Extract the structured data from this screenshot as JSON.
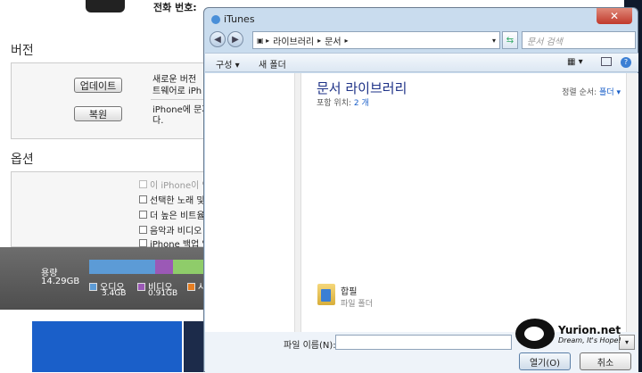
{
  "itunes": {
    "serial_label": "전화 번호:",
    "version_title": "버전",
    "update_button": "업데이트",
    "restore_button": "복원",
    "update_text_1": "새로운 버전",
    "update_text_2": "트웨어로 iPh",
    "restore_text_1": "iPhone에 문자",
    "restore_text_2": "다.",
    "options_title": "옵션",
    "options": [
      {
        "label": "이 iPhone이 연",
        "checked": false,
        "disabled": true
      },
      {
        "label": "선택한 노래 및",
        "checked": false,
        "disabled": false
      },
      {
        "label": "더 높은 비트율",
        "checked": false,
        "disabled": false
      },
      {
        "label": "음악과 비디오",
        "checked": false,
        "disabled": false
      },
      {
        "label": "iPhone 백업 암",
        "checked": false,
        "disabled": false
      }
    ],
    "capacity": {
      "label": "용량",
      "total": "14.29GB",
      "segments": [
        {
          "name": "오디오",
          "size": "3.4GB",
          "color": "#5c9bd6"
        },
        {
          "name": "비디오",
          "size": "0.91GB",
          "color": "#9b59b6"
        },
        {
          "name": "사",
          "size": "",
          "color": "#e67e22"
        }
      ]
    }
  },
  "dialog": {
    "title": "iTunes",
    "breadcrumb": [
      "라이브러리",
      "문서"
    ],
    "search_placeholder": "문서 검색",
    "toolbar": {
      "organize": "구성 ▾",
      "new_folder": "새 폴더"
    },
    "library_title": "문서 라이브러리",
    "library_includes": "포함 위치:",
    "library_count": "2 개",
    "sort_label": "정렬 순서:",
    "sort_value": "폴더 ▾",
    "folder": {
      "name": "합필",
      "type": "파일 폴더"
    },
    "filename_label": "파일 이름(N):",
    "open_button": "열기(O)",
    "cancel_button": "취소"
  },
  "watermark": {
    "name": "Yurion.net",
    "tagline": "Dream, It's Hope!"
  }
}
